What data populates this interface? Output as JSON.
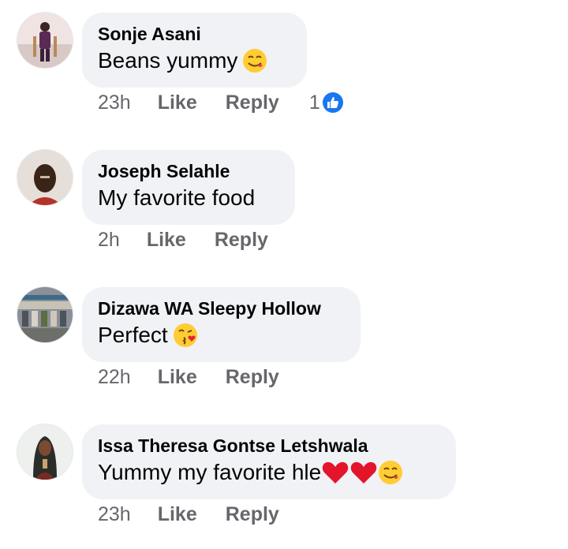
{
  "comments": [
    {
      "author": "Sonje Asani",
      "text": "Beans yummy",
      "emojis": [
        "yum-face"
      ],
      "time": "23h",
      "like_label": "Like",
      "reply_label": "Reply",
      "reaction_count": "1",
      "reaction_icon": "thumbs-up-icon"
    },
    {
      "author": "Joseph Selahle",
      "text": "My favorite food",
      "emojis": [],
      "time": "2h",
      "like_label": "Like",
      "reply_label": "Reply"
    },
    {
      "author": "Dizawa WA Sleepy Hollow",
      "text": "Perfect",
      "emojis": [
        "kiss-face"
      ],
      "time": "22h",
      "like_label": "Like",
      "reply_label": "Reply"
    },
    {
      "author": "Issa Theresa Gontse Letshwala",
      "text": "Yummy my favorite hle",
      "emojis": [
        "red-heart",
        "red-heart",
        "yum-face"
      ],
      "time": "23h",
      "like_label": "Like",
      "reply_label": "Reply"
    }
  ],
  "colors": {
    "bubble": "#f0f2f5",
    "meta_text": "#65676b",
    "like_blue": "#1877f2"
  }
}
